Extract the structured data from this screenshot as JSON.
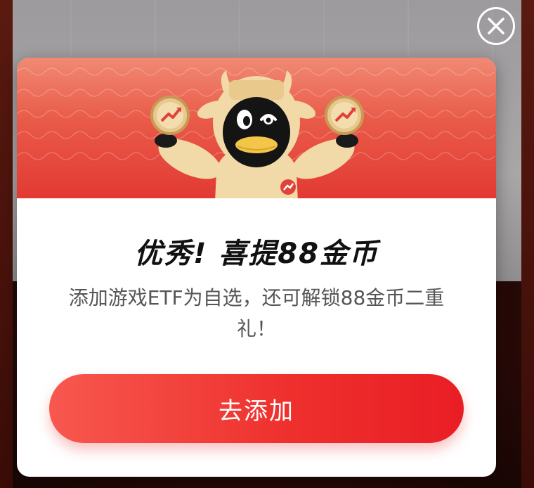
{
  "dialog": {
    "title": "优秀! 喜提88金币",
    "description": "添加游戏ETF为自选，还可解锁88金币二重礼！",
    "cta_label": "去添加"
  },
  "icons": {
    "close": "close-icon",
    "coin": "trend-coin-icon",
    "mascot": "bull-mascot"
  },
  "colors": {
    "accent": "#ee2f2c",
    "banner_top": "#f08a74",
    "banner_bottom": "#e23a33",
    "title": "#111111",
    "text": "#555555"
  }
}
